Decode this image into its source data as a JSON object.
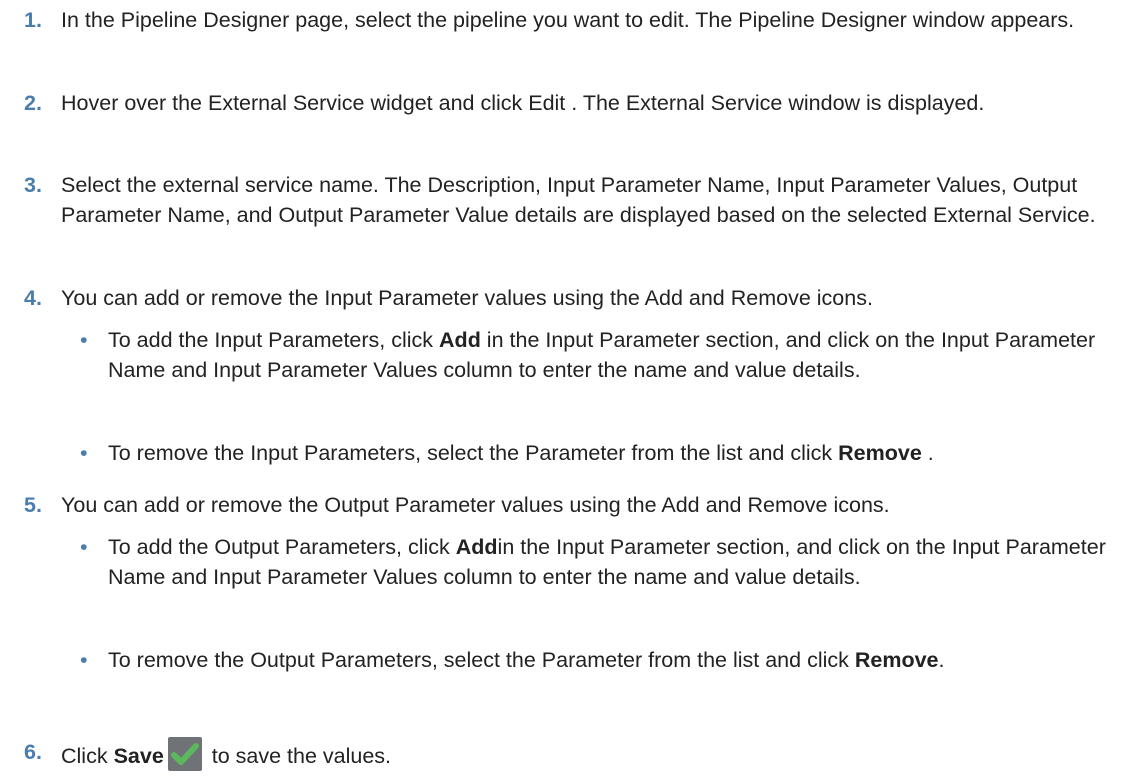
{
  "steps": [
    {
      "num": "1.",
      "text": "In the Pipeline Designer page, select the pipeline you want to edit. The Pipeline Designer window appears."
    },
    {
      "num": "2.",
      "text": "Hover over the External Service widget and click Edit . The External Service window is displayed."
    },
    {
      "num": "3.",
      "text": "Select the external service name. The Description, Input Parameter Name, Input Parameter Values, Output Parameter Name, and Output Parameter Value details are displayed based on the selected External Service."
    },
    {
      "num": "4.",
      "text": "You can add or remove the Input Parameter values using the Add and Remove icons.",
      "bullets": [
        {
          "pre": "To add the Input Parameters, click ",
          "bold": "Add",
          "post": " in the Input Parameter section, and click on the Input Parameter Name and Input Parameter Values column to enter the name and value details."
        },
        {
          "pre": "To remove the Input Parameters, select the Parameter from the list and click ",
          "bold": "Remove",
          "post": " ."
        }
      ]
    },
    {
      "num": "5.",
      "text": "You can add or remove the Output Parameter values using the Add and Remove icons.",
      "bullets": [
        {
          "pre": "To add the Output Parameters, click ",
          "bold": "Add",
          "post": "in the Input Parameter section, and click on the Input Parameter Name and Input Parameter Values column to enter the name and value details."
        },
        {
          "pre": "To remove the Output Parameters, select the Parameter from the list and click ",
          "bold": "Remove",
          "post": "."
        }
      ]
    },
    {
      "num": "6.",
      "pre": "Click ",
      "bold": "Save",
      "post": " to save the values.",
      "icon": "save-checkmark-icon",
      "icon_color": "#5cb85c"
    }
  ],
  "colors": {
    "step_number": "#4a7cae",
    "text": "#222222"
  }
}
